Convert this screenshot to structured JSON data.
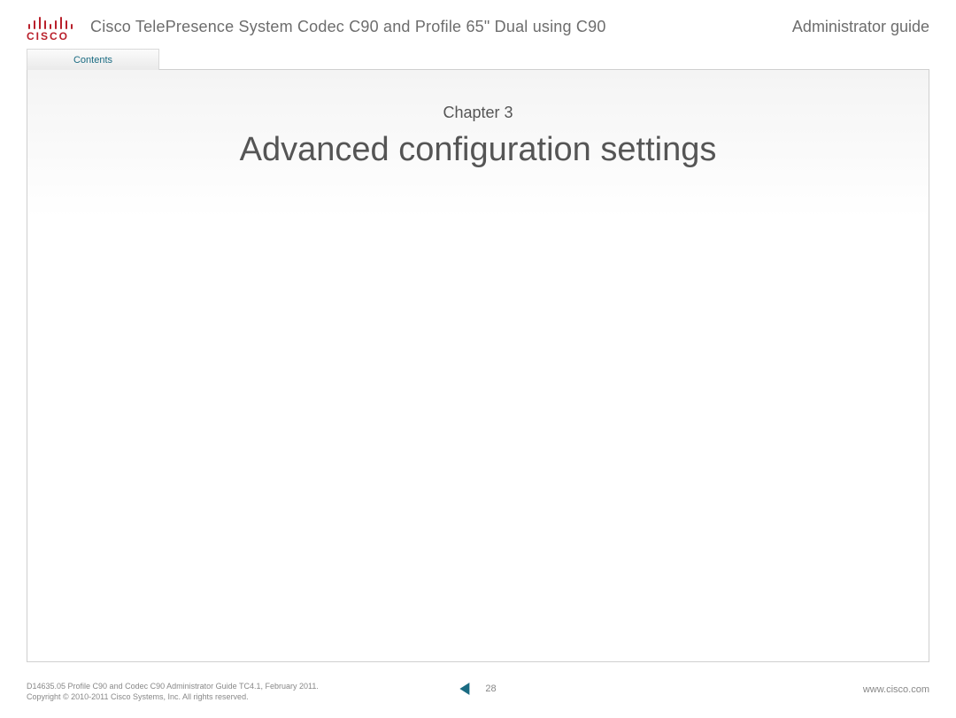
{
  "header": {
    "logo_text": "CISCO",
    "doc_title": "Cisco TelePresence System Codec C90 and Profile 65\" Dual using C90",
    "doc_guide": "Administrator guide"
  },
  "tabs": {
    "contents_label": "Contents"
  },
  "chapter": {
    "label": "Chapter 3",
    "title": "Advanced configuration settings"
  },
  "footer": {
    "line1": "D14635.05 Profile C90 and Codec C90 Administrator Guide TC4.1, February 2011.",
    "line2": "Copyright © 2010-2011 Cisco Systems, Inc. All rights reserved.",
    "page_number": "28",
    "url": "www.cisco.com"
  }
}
